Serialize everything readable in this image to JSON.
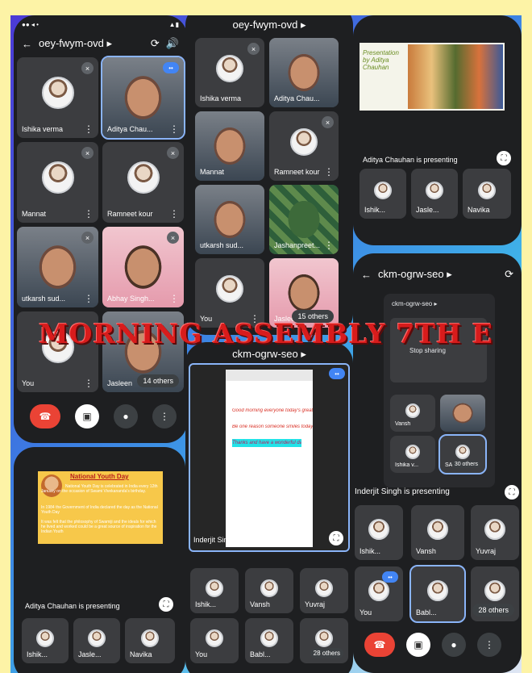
{
  "overlay_title": "MORNING ASSEMBLY 7TH E",
  "colors": {
    "accent": "#8ab4f8",
    "end_call": "#ea4335",
    "title": "#d81c1c",
    "page_bg": "#fdf3a6"
  },
  "p1": {
    "status": "●● ◂ •",
    "meeting_code": "oey-fwym-ovd ▸",
    "tiles": [
      {
        "name": "Ishika verma"
      },
      {
        "name": "Aditya Chau..."
      },
      {
        "name": "Mannat"
      },
      {
        "name": "Ramneet kour"
      },
      {
        "name": "utkarsh sud..."
      },
      {
        "name": "Abhay Singh..."
      },
      {
        "name": "You"
      },
      {
        "name": "Jasleen"
      }
    ],
    "others": "14 others"
  },
  "p2": {
    "meeting_code": "oey-fwym-ovd ▸",
    "tiles": [
      {
        "name": "Ishika verma"
      },
      {
        "name": "Aditya Chau..."
      },
      {
        "name": "Mannat"
      },
      {
        "name": "Ramneet kour"
      },
      {
        "name": "utkarsh sud..."
      },
      {
        "name": "Jashanpreet..."
      },
      {
        "name": "You"
      },
      {
        "name": "Jasleen"
      }
    ],
    "others": "15 others"
  },
  "p3": {
    "slide_title": "Presentation by Aditya Chauhan",
    "presenting": "Aditya Chauhan is presenting",
    "tiles": [
      {
        "name": "Ishik..."
      },
      {
        "name": "Jasle..."
      },
      {
        "name": "Navika"
      }
    ]
  },
  "p4": {
    "meeting_code": "ckm-ogrw-seo ▸",
    "inner_code": "ckm-ogrw-seo ▸",
    "stop_sharing": "Stop sharing",
    "inner_tiles": [
      {
        "name": "Vansh"
      },
      {
        "name": ""
      },
      {
        "name": "Ishika v..."
      },
      {
        "name": "SA"
      }
    ],
    "inner_others": "30 others",
    "presenting": "Inderjit Singh is presenting",
    "tiles": [
      {
        "name": "Ishik..."
      },
      {
        "name": "Vansh"
      },
      {
        "name": "Yuvraj"
      },
      {
        "name": "You"
      },
      {
        "name": "Babl..."
      },
      {
        "name": ""
      }
    ],
    "others": "28 others"
  },
  "p5": {
    "meeting_code": "ckm-ogrw-seo ▸",
    "doc_lines": [
      "Good morning everyone today's great",
      "Be one reason someone smiles today",
      "Thanks and have a wonderful day"
    ],
    "presenting": "Inderjit Singh is presenting",
    "tiles": [
      {
        "name": "Ishik..."
      },
      {
        "name": "Vansh"
      },
      {
        "name": "Yuvraj"
      },
      {
        "name": "You"
      },
      {
        "name": "Babl..."
      },
      {
        "name": ""
      }
    ],
    "others": "28 others"
  },
  "p6": {
    "slide_heading": "National Youth Day",
    "slide_bullets": [
      "National Youth Day is celebrated in India every 12th January on the occasion of Swami Vivekananda's birthday.",
      "In 1984 the Government of India declared the day as the National Youth Day",
      "It was felt that the philosophy of Swamiji and the ideals for which he lived and worked could be a great source of inspiration for the Indian Youth"
    ],
    "presenting": "Aditya Chauhan is presenting",
    "tiles": [
      {
        "name": "Ishik..."
      },
      {
        "name": "Jasle..."
      },
      {
        "name": "Navika"
      }
    ]
  }
}
